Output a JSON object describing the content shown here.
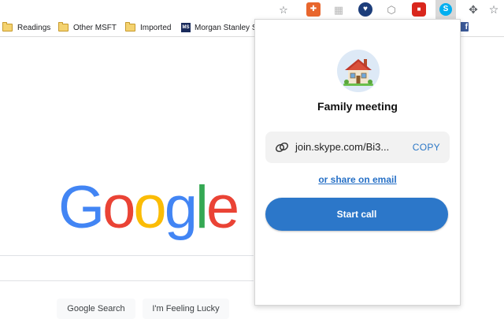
{
  "bookmarks": {
    "items": [
      {
        "label": "Readings",
        "icon": "folder-icon"
      },
      {
        "label": "Other MSFT",
        "icon": "folder-icon"
      },
      {
        "label": "Imported",
        "icon": "folder-icon"
      },
      {
        "label": "Morgan Stanley S",
        "icon": "morgan-stanley-icon",
        "badge": "MS"
      }
    ],
    "facebook_glyph": "f"
  },
  "extensions": [
    {
      "name": "star-settings-icon",
      "glyph": "☆"
    },
    {
      "name": "orange-extension-icon",
      "glyph": "✚"
    },
    {
      "name": "grid-extension-icon",
      "glyph": "▦"
    },
    {
      "name": "heart-extension-icon",
      "glyph": "♥"
    },
    {
      "name": "shield-extension-icon",
      "glyph": "⬡"
    },
    {
      "name": "red-extension-icon",
      "glyph": "■"
    },
    {
      "name": "skype-icon",
      "glyph": "S"
    },
    {
      "name": "puzzle-icon",
      "glyph": "✥"
    },
    {
      "name": "bookmark-star-icon",
      "glyph": "☆"
    }
  ],
  "google": {
    "logo_letters": [
      "G",
      "o",
      "o",
      "g",
      "l",
      "e"
    ],
    "search_button": "Google Search",
    "lucky_button": "I'm Feeling Lucky"
  },
  "popup": {
    "avatar_icon": "house-icon",
    "title": "Family meeting",
    "link_text": "join.skype.com/Bi3...",
    "copy_label": "COPY",
    "share_label": "or share on email",
    "start_call_label": "Start call"
  },
  "colors": {
    "google_blue": "#4285f4",
    "google_red": "#ea4335",
    "google_yellow": "#fbbc05",
    "google_green": "#34a853",
    "skype_blue": "#2c77c9",
    "link_blue": "#2670c6"
  }
}
